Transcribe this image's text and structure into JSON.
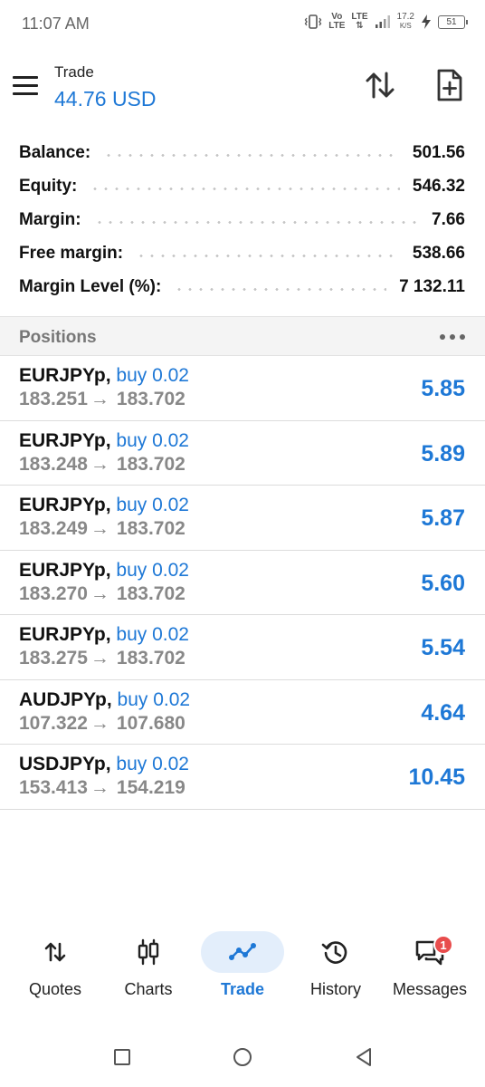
{
  "status_bar": {
    "time": "11:07 AM",
    "volte": [
      "Vo",
      "LTE"
    ],
    "lte": [
      "LTE",
      "⇅"
    ],
    "speed": [
      "17.2",
      "K/S"
    ],
    "battery": "51"
  },
  "header": {
    "title": "Trade",
    "amount": "44.76 USD"
  },
  "summary": [
    {
      "label": "Balance:",
      "value": "501.56"
    },
    {
      "label": "Equity:",
      "value": "546.32"
    },
    {
      "label": "Margin:",
      "value": "7.66"
    },
    {
      "label": "Free margin:",
      "value": "538.66"
    },
    {
      "label": "Margin Level (%):",
      "value": "7 132.11"
    }
  ],
  "positions": {
    "title": "Positions",
    "items": [
      {
        "symbol": "EURJPYp,",
        "side": "buy 0.02",
        "open": "183.251",
        "current": "183.702",
        "profit": "5.85"
      },
      {
        "symbol": "EURJPYp,",
        "side": "buy 0.02",
        "open": "183.248",
        "current": "183.702",
        "profit": "5.89"
      },
      {
        "symbol": "EURJPYp,",
        "side": "buy 0.02",
        "open": "183.249",
        "current": "183.702",
        "profit": "5.87"
      },
      {
        "symbol": "EURJPYp,",
        "side": "buy 0.02",
        "open": "183.270",
        "current": "183.702",
        "profit": "5.60"
      },
      {
        "symbol": "EURJPYp,",
        "side": "buy 0.02",
        "open": "183.275",
        "current": "183.702",
        "profit": "5.54"
      },
      {
        "symbol": "AUDJPYp,",
        "side": "buy 0.02",
        "open": "107.322",
        "current": "107.680",
        "profit": "4.64"
      },
      {
        "symbol": "USDJPYp,",
        "side": "buy 0.02",
        "open": "153.413",
        "current": "154.219",
        "profit": "10.45"
      }
    ]
  },
  "bottom_nav": [
    {
      "label": "Quotes",
      "icon": "quotes-icon",
      "active": false
    },
    {
      "label": "Charts",
      "icon": "charts-icon",
      "active": false
    },
    {
      "label": "Trade",
      "icon": "trade-icon",
      "active": true
    },
    {
      "label": "History",
      "icon": "history-icon",
      "active": false
    },
    {
      "label": "Messages",
      "icon": "messages-icon",
      "active": false,
      "badge": "1"
    }
  ],
  "colors": {
    "accent": "#1e78d6",
    "badge": "#e84c4c"
  }
}
